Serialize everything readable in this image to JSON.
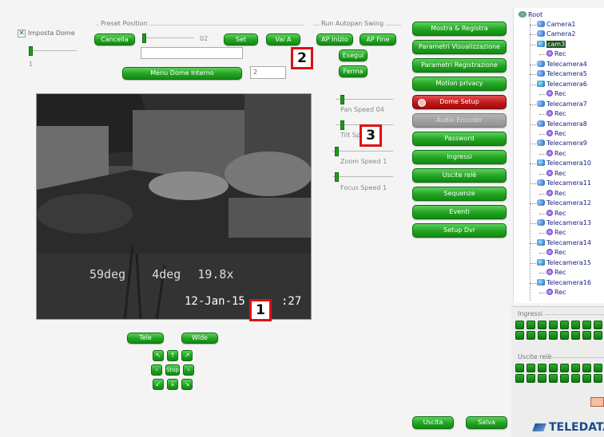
{
  "dome": {
    "checkbox_label": "Imposta Dome",
    "checked": true,
    "slider_value": "1"
  },
  "preset": {
    "group_label": "Preset Position",
    "delete_button": "Cancella",
    "slider_value": "02",
    "set_button": "Set",
    "goto_button": "Vai A",
    "name_value": "",
    "menu_button": "Menu Dome Interno",
    "menu_value": "2"
  },
  "autopan": {
    "group_label": "Run Autopan Swing",
    "start_button": "AP Inizio",
    "end_button": "AP Fine",
    "run_button": "Esegui",
    "stop_button": "Ferma"
  },
  "video": {
    "overlay_line1": [
      "59deg",
      "4deg",
      "19.8x"
    ],
    "date": "12-Jan-15",
    "time": ":27"
  },
  "speeds": [
    {
      "label": "Pan Speed 04",
      "level": 0.1
    },
    {
      "label": "Tilt Speed",
      "level": 0.1
    },
    {
      "label": "Zoom Speed 1",
      "level": 0.05
    },
    {
      "label": "Focus Speed 1",
      "level": 0.05
    }
  ],
  "menu": [
    {
      "label": "Mostra & Registra",
      "state": "normal"
    },
    {
      "label": "Parametri Visualizzazione",
      "state": "normal"
    },
    {
      "label": "Parametri Registrazione",
      "state": "normal"
    },
    {
      "label": "Motion privacy",
      "state": "normal"
    },
    {
      "label": "Dome Setup",
      "state": "active"
    },
    {
      "label": "Audio Encoder",
      "state": "disabled"
    },
    {
      "label": "Password",
      "state": "normal"
    },
    {
      "label": "Ingressi",
      "state": "normal"
    },
    {
      "label": "Uscite relè",
      "state": "normal"
    },
    {
      "label": "Sequenze",
      "state": "normal"
    },
    {
      "label": "Eventi",
      "state": "normal"
    },
    {
      "label": "Setup Dvr",
      "state": "normal"
    }
  ],
  "zoom": {
    "tele_button": "Tele",
    "wide_button": "Wide",
    "stop_button": "Stop"
  },
  "footer": {
    "exit_button": "Uscita",
    "save_button": "Salva",
    "brand": "TELEDATA"
  },
  "io": {
    "inputs_label": "Ingressi",
    "outputs_label": "Uscite relè"
  },
  "tree": {
    "root": "Root",
    "items": [
      {
        "label": "Camera1",
        "kind": "cam",
        "depth": 1
      },
      {
        "label": "Camera2",
        "kind": "cam",
        "depth": 1
      },
      {
        "label": "cam3",
        "kind": "dome",
        "depth": 1,
        "selected": true
      },
      {
        "label": "Rec",
        "kind": "rec",
        "depth": 2
      },
      {
        "label": "Telecamera4",
        "kind": "cam",
        "depth": 1
      },
      {
        "label": "Telecamera5",
        "kind": "cam",
        "depth": 1
      },
      {
        "label": "Telecamera6",
        "kind": "dome",
        "depth": 1
      },
      {
        "label": "Rec",
        "kind": "rec",
        "depth": 2
      },
      {
        "label": "Telecamera7",
        "kind": "cam",
        "depth": 1
      },
      {
        "label": "Rec",
        "kind": "rec",
        "depth": 2
      },
      {
        "label": "Telecamera8",
        "kind": "cam",
        "depth": 1
      },
      {
        "label": "Rec",
        "kind": "rec",
        "depth": 2
      },
      {
        "label": "Telecamera9",
        "kind": "cam",
        "depth": 1
      },
      {
        "label": "Rec",
        "kind": "rec",
        "depth": 2
      },
      {
        "label": "Telecamera10",
        "kind": "dome",
        "depth": 1
      },
      {
        "label": "Rec",
        "kind": "rec",
        "depth": 2
      },
      {
        "label": "Telecamera11",
        "kind": "cam",
        "depth": 1
      },
      {
        "label": "Rec",
        "kind": "rec",
        "depth": 2
      },
      {
        "label": "Telecamera12",
        "kind": "cam",
        "depth": 1
      },
      {
        "label": "Rec",
        "kind": "rec",
        "depth": 2
      },
      {
        "label": "Telecamera13",
        "kind": "cam",
        "depth": 1
      },
      {
        "label": "Rec",
        "kind": "rec",
        "depth": 2
      },
      {
        "label": "Telecamera14",
        "kind": "dome",
        "depth": 1
      },
      {
        "label": "Rec",
        "kind": "rec",
        "depth": 2
      },
      {
        "label": "Telecamera15",
        "kind": "dome",
        "depth": 1
      },
      {
        "label": "Rec",
        "kind": "rec",
        "depth": 2
      },
      {
        "label": "Telecamera16",
        "kind": "dome",
        "depth": 1
      },
      {
        "label": "Rec",
        "kind": "rec",
        "depth": 2
      }
    ]
  },
  "annotations": [
    "1",
    "2",
    "3"
  ]
}
